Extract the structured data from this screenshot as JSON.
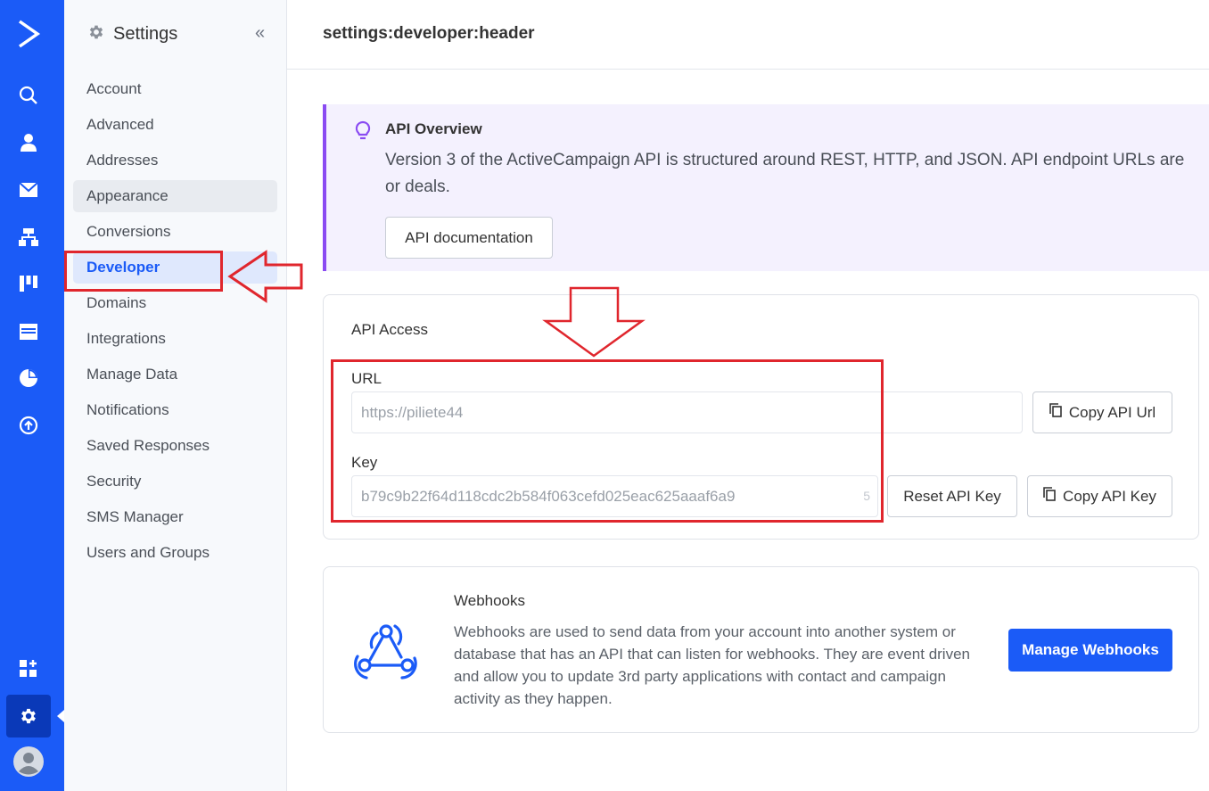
{
  "rail": {
    "icons": [
      "logo-icon",
      "search-icon",
      "contacts-icon",
      "email-icon",
      "automations-icon",
      "deals-icon",
      "site-icon",
      "reports-icon",
      "upgrade-icon",
      "apps-icon",
      "settings-icon",
      "profile-icon"
    ],
    "brand_color": "#1b5bf7"
  },
  "sidebar": {
    "title": "Settings",
    "collapse_label": "«",
    "items": [
      {
        "label": "Account"
      },
      {
        "label": "Advanced"
      },
      {
        "label": "Addresses"
      },
      {
        "label": "Appearance"
      },
      {
        "label": "Conversions"
      },
      {
        "label": "Developer"
      },
      {
        "label": "Domains"
      },
      {
        "label": "Integrations"
      },
      {
        "label": "Manage Data"
      },
      {
        "label": "Notifications"
      },
      {
        "label": "Saved Responses"
      },
      {
        "label": "Security"
      },
      {
        "label": "SMS Manager"
      },
      {
        "label": "Users and Groups"
      }
    ],
    "active_item": "Developer"
  },
  "header": {
    "title": "settings:developer:header"
  },
  "overview": {
    "title": "API Overview",
    "line1": "Version 3 of the ActiveCampaign API is structured around REST, HTTP, and JSON. API endpoint URLs are",
    "line2": "or deals.",
    "doc_button": "API documentation",
    "accent_color": "#8a4bf2"
  },
  "api_access": {
    "title": "API Access",
    "url_label": "URL",
    "url_value": "https://piliete44",
    "copy_url_button": "Copy API Url",
    "key_label": "Key",
    "key_value": "b79c9b22f64d118cdc2b584f063cefd025eac625aaaf6a9",
    "key_trail": "5",
    "reset_button": "Reset API Key",
    "copy_key_button": "Copy API Key"
  },
  "webhooks": {
    "title": "Webhooks",
    "description": "Webhooks are used to send data from your account into another system or database that has an API that can listen for webhooks. They are event driven and allow you to update 3rd party applications with contact and campaign activity as they happen.",
    "manage_button": "Manage Webhooks"
  },
  "annotation_color": "#e0262d"
}
